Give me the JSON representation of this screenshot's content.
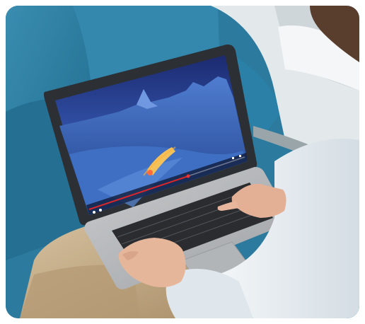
{
  "photo": {
    "subject": "",
    "colors": {
      "seat_blue": "#2f7fa3",
      "seat_blue_dark": "#1f6687",
      "laptop_body": "#2f3237",
      "laptop_deck": "#b9bbbd",
      "sky_top": "#1e2f76",
      "sky_bottom": "#3559b2",
      "snow": "#4c76c6",
      "video_progress": "#d8262b",
      "shirt": "#e8eef3",
      "trousers": "#c9b08c",
      "skin": "#e6b69b",
      "window_panel": "#e7ebec"
    }
  }
}
